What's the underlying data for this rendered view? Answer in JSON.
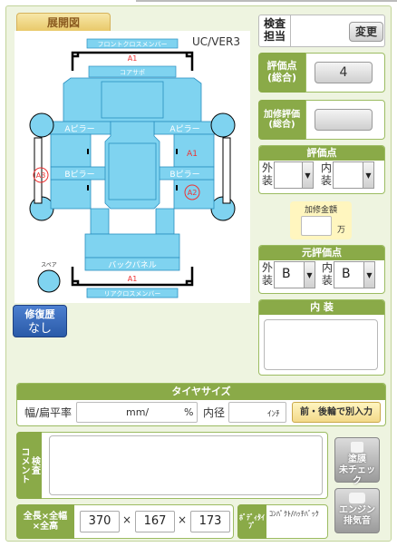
{
  "diagram": {
    "tab_label": "展開図",
    "model_label": "UC/VER3",
    "parts": {
      "front_cross_member": "フロントクロスメンバー",
      "core_support": "コアサポ",
      "a_pillar_left": "Aピラー",
      "a_pillar_right": "Aピラー",
      "b_pillar_left": "Bピラー",
      "b_pillar_right": "Bピラー",
      "back_panel": "バックパネル",
      "rear_cross_member": "リアクロスメンバー",
      "spare": "スペア"
    },
    "marks": {
      "front": "A1",
      "right_a1": "A1",
      "right_a2": "A2",
      "left_a3": "A3",
      "rear": "A1"
    }
  },
  "repair_history": {
    "label": "修復歴",
    "value": "なし"
  },
  "inspector": {
    "label": "検査\n担当",
    "value": "",
    "change_button": "変更"
  },
  "score": {
    "label": "評価点\n(総合)",
    "value": "4"
  },
  "repair_score": {
    "label": "加修評価\n(総合)",
    "value": ""
  },
  "hyoka": {
    "header": "評価点",
    "exterior_label": "外\n装",
    "exterior_value": "",
    "interior_label": "内\n装",
    "interior_value": ""
  },
  "repair_amount": {
    "label": "加修金額",
    "value": "",
    "unit": "万"
  },
  "original": {
    "header": "元評価点",
    "exterior_label": "外\n装",
    "exterior_value": "B",
    "interior_label": "内\n装",
    "interior_value": "B"
  },
  "interior_notes": {
    "header": "内 装",
    "value": ""
  },
  "tire": {
    "header": "タイヤサイズ",
    "width_label": "幅/扁平率",
    "mm_unit": "mm/",
    "pct_unit": "%",
    "inner_label": "内径",
    "inch_unit": "ｲﾝﾁ",
    "split_button": "前・後輪で別入力"
  },
  "comment": {
    "label": "検査\nコメント",
    "value": ""
  },
  "paint_button": {
    "label": "塗膜\n未チェック"
  },
  "engine_button": {
    "label": "エンジン\n排気音"
  },
  "dimensions": {
    "label": "全長×全幅\n×全高",
    "length": "370",
    "width": "167",
    "height": "173",
    "times": "×"
  },
  "body_type": {
    "label": "ﾎﾞﾃﾞｨﾀｲﾌﾟ",
    "value": "ｺﾝﾊﾟｸﾄ/ﾊｯﾁﾊﾞｯｸ"
  }
}
